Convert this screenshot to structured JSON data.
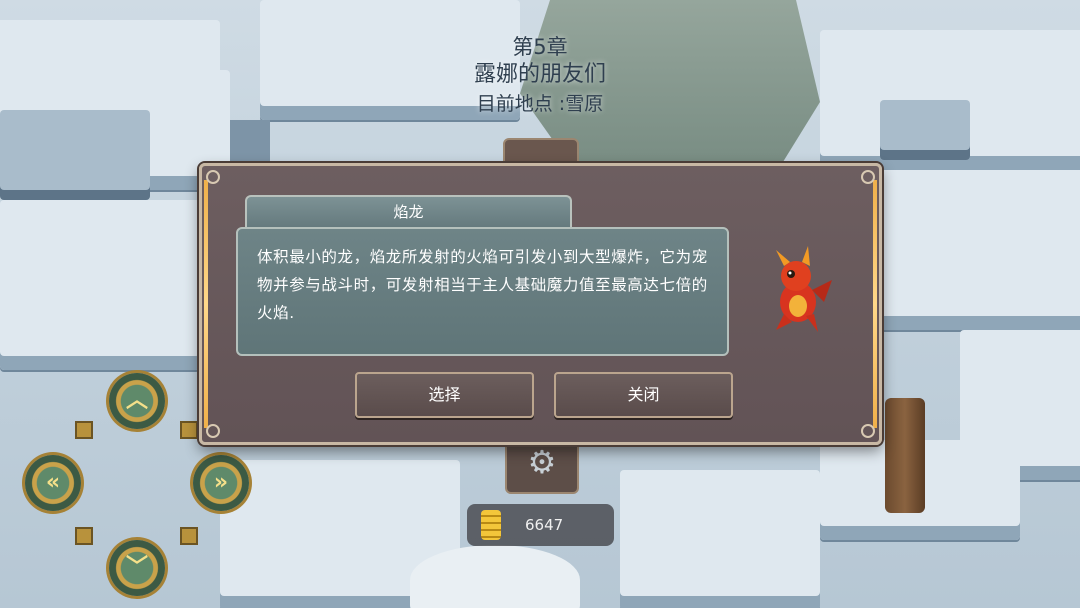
{
  "chapter": {
    "number": "第5章",
    "title": "露娜的朋友们",
    "location": "目前地点 :雪原"
  },
  "hud": {
    "coins": "6647",
    "dpad": {
      "up_icon": "chevron-up-icon",
      "left_icon": "chevron-left-icon",
      "right_icon": "chevron-right-icon",
      "down_icon": "chevron-down-icon"
    }
  },
  "dialog": {
    "name": "焰龙",
    "description": "体积最小的龙，焰龙所发射的火焰可引发小到大型爆炸，它为宠物并参与战斗时，可发射相当于主人基础魔力值至最高达七倍的火焰.",
    "select_label": "选择",
    "close_label": "关闭",
    "pet_icon": "fire-dragon-icon"
  },
  "colors": {
    "dialog_bg": "#665759",
    "dialog_border": "#c8b8a4",
    "accent_gold": "#f0b04a",
    "text_box_bg": "#677d80"
  }
}
